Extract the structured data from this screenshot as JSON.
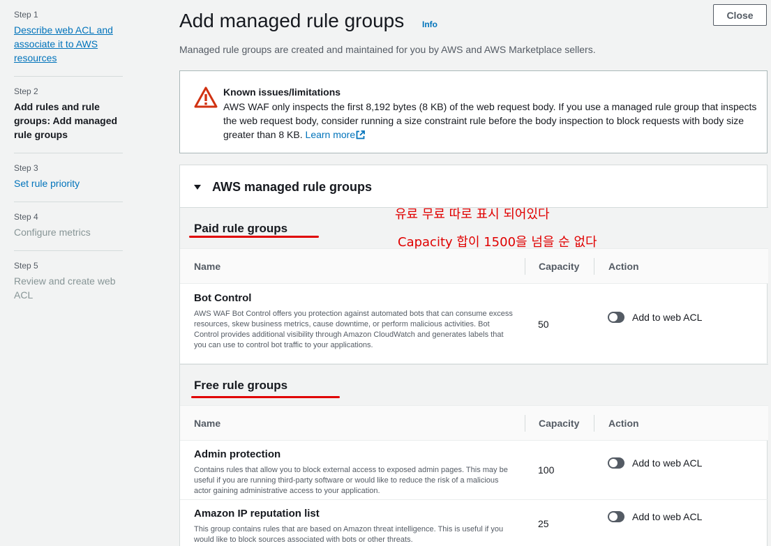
{
  "sidebar": {
    "steps": [
      {
        "num": "Step 1",
        "title": "Describe web ACL and associate it to AWS resources"
      },
      {
        "num": "Step 2",
        "title": "Add rules and rule groups: Add managed rule groups"
      },
      {
        "num": "Step 3",
        "title": "Set rule priority"
      },
      {
        "num": "Step 4",
        "title": "Configure metrics"
      },
      {
        "num": "Step 5",
        "title": "Review and create web ACL"
      }
    ]
  },
  "header": {
    "title": "Add managed rule groups",
    "info": "Info",
    "subtitle": "Managed rule groups are created and maintained for you by AWS and AWS Marketplace sellers.",
    "close": "Close"
  },
  "alert": {
    "title": "Known issues/limitations",
    "body": "AWS WAF only inspects the first 8,192 bytes (8 KB) of the web request body. If you use a managed rule group that inspects the web request body, consider running a size constraint rule before the body inspection to block requests with body size greater than 8 KB.",
    "link": "Learn more"
  },
  "panel": {
    "title": "AWS managed rule groups",
    "columns": {
      "name": "Name",
      "capacity": "Capacity",
      "action": "Action"
    },
    "paid": {
      "title": "Paid rule groups",
      "rows": [
        {
          "name": "Bot Control",
          "desc": "AWS WAF Bot Control offers you protection against automated bots that can consume excess resources, skew business metrics, cause downtime, or perform malicious activities. Bot Control provides additional visibility through Amazon CloudWatch and generates labels that you can use to control bot traffic to your applications.",
          "capacity": "50",
          "action": "Add to web ACL"
        }
      ]
    },
    "free": {
      "title": "Free rule groups",
      "rows": [
        {
          "name": "Admin protection",
          "desc": "Contains rules that allow you to block external access to exposed admin pages. This may be useful if you are running third-party software or would like to reduce the risk of a malicious actor gaining administrative access to your application.",
          "capacity": "100",
          "action": "Add to web ACL"
        },
        {
          "name": "Amazon IP reputation list",
          "desc": "This group contains rules that are based on Amazon threat intelligence. This is useful if you would like to block sources associated with bots or other threats.",
          "capacity": "25",
          "action": "Add to web ACL"
        }
      ]
    }
  },
  "annotations": {
    "line1": "유료 무료 따로 표시 되어있다",
    "line2": "Capacity 합이 1500을 넘을 순 없다"
  },
  "colors": {
    "link": "#0073bb",
    "annotation": "#e00000",
    "warning": "#d13212"
  }
}
